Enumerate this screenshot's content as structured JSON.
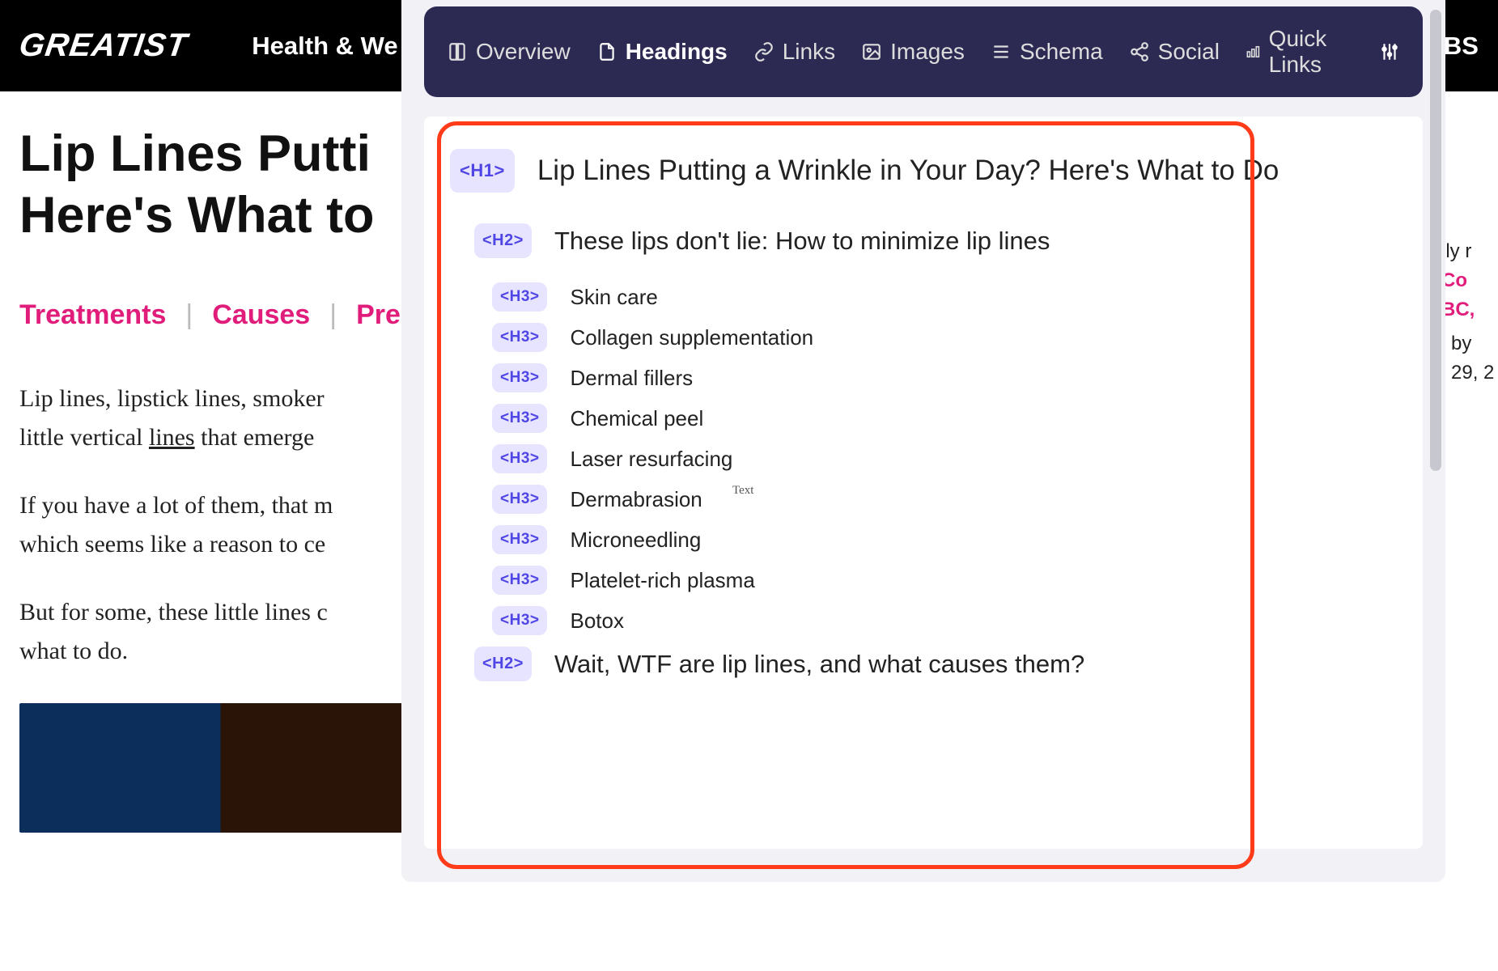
{
  "header": {
    "logo": "GREATIST",
    "nav": [
      "Health & We"
    ],
    "right_nav_frag": "BS"
  },
  "page": {
    "title_line1": "Lip Lines Putti",
    "title_line2": "Here's What to",
    "tabs": [
      "Treatments",
      "Causes",
      "Pre"
    ],
    "paragraphs": [
      {
        "prefix": "Lip lines, lipstick lines, smoker",
        "line2_a": "little vertical ",
        "line2_underline": "lines",
        "line2_b": " that emerge"
      },
      {
        "line1": "If you have a lot of them, that m",
        "line2": "which seems like a reason to ce"
      },
      {
        "line1": "But for some, these little lines c",
        "line2": "what to do."
      }
    ]
  },
  "right_fragment": {
    "l1": "lly r",
    "l2": "Co",
    "l3": "BC,",
    "l4": "by ",
    "l5": "29, 2"
  },
  "extension": {
    "tabs": [
      {
        "id": "overview",
        "label": "Overview",
        "icon": "book"
      },
      {
        "id": "headings",
        "label": "Headings",
        "icon": "file",
        "active": true
      },
      {
        "id": "links",
        "label": "Links",
        "icon": "link"
      },
      {
        "id": "images",
        "label": "Images",
        "icon": "image"
      },
      {
        "id": "schema",
        "label": "Schema",
        "icon": "list"
      },
      {
        "id": "social",
        "label": "Social",
        "icon": "share"
      },
      {
        "id": "quicklinks",
        "label": "Quick Links",
        "icon": "chart"
      }
    ],
    "headings": [
      {
        "level": "H1",
        "text": "Lip Lines Putting a Wrinkle in Your Day? Here's What to Do"
      },
      {
        "level": "H2",
        "text": "These lips don't lie: How to minimize lip lines"
      },
      {
        "level": "H3",
        "text": "Skin care"
      },
      {
        "level": "H3",
        "text": "Collagen supplementation"
      },
      {
        "level": "H3",
        "text": "Dermal fillers"
      },
      {
        "level": "H3",
        "text": "Chemical peel"
      },
      {
        "level": "H3",
        "text": "Laser resurfacing"
      },
      {
        "level": "H3",
        "text": "Dermabrasion"
      },
      {
        "level": "H3",
        "text": "Microneedling"
      },
      {
        "level": "H3",
        "text": "Platelet-rich plasma"
      },
      {
        "level": "H3",
        "text": "Botox"
      },
      {
        "level": "H2",
        "text": "Wait, WTF are lip lines, and what causes them?"
      }
    ],
    "floating_label": "Text"
  }
}
